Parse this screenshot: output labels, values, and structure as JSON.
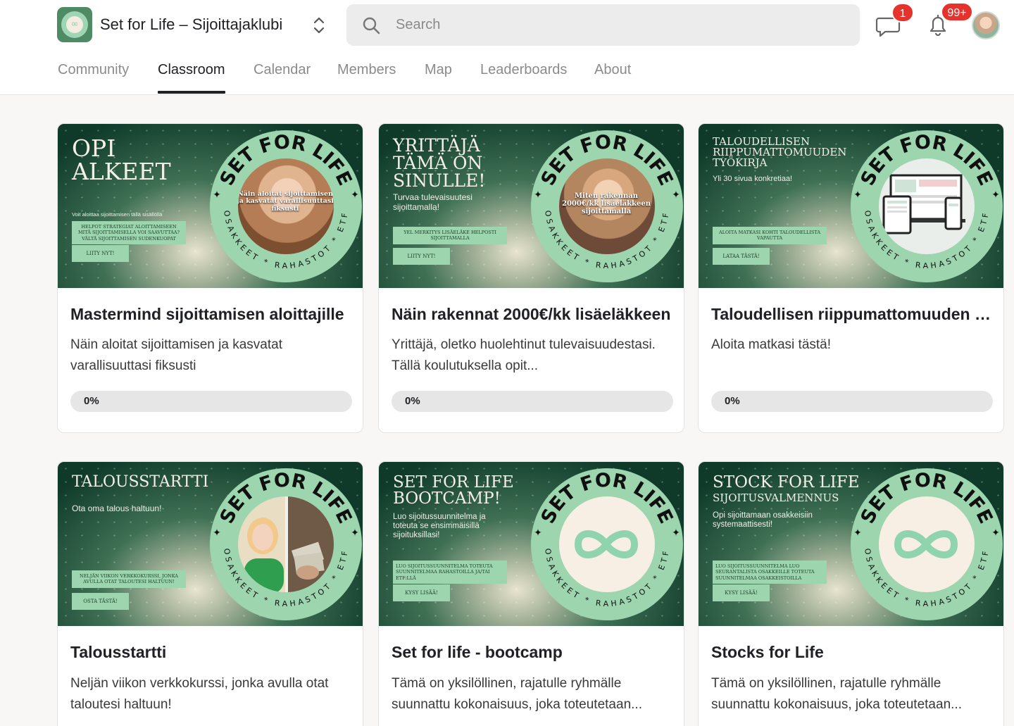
{
  "header": {
    "group_name": "Set for Life – Sijoittajaklubi",
    "search_placeholder": "Search",
    "chat_badge": "1",
    "notifications_badge": "99+"
  },
  "tabs": [
    {
      "label": "Community",
      "active": false
    },
    {
      "label": "Classroom",
      "active": true
    },
    {
      "label": "Calendar",
      "active": false
    },
    {
      "label": "Members",
      "active": false
    },
    {
      "label": "Map",
      "active": false
    },
    {
      "label": "Leaderboards",
      "active": false
    },
    {
      "label": "About",
      "active": false
    }
  ],
  "colors": {
    "accent_green": "#9cd5ae",
    "badge_red": "#e5322d",
    "cover_dark": "#0f3a2a"
  },
  "ring": {
    "top_text": "SET FOR LIFE",
    "bottom_text": "OSAKKEET * RAHASTOT * ETF"
  },
  "courses": [
    {
      "cover_title": "OPI ALKEET",
      "cover_subtitle": "Voit aloittaa sijoittamisen tällä sisällöllä",
      "cover_pill": "HELPOT STRATEGIAT ALOITTAMISEEN MITÄ SIJOITTAMISELLA VOI SAAVUTTAA? VÄLTÄ SIJOITTAMISEN SUDENKUOPAT",
      "cover_button": "LIITY NYT!",
      "photo_caption": "Näin aloitat sijoittamisen ja kasvatat varallisuuttasi fiksusti",
      "title": "Mastermind sijoittamisen aloittajille",
      "description": "Näin aloitat sijoittamisen ja kasvatat varallisuuttasi fiksusti",
      "progress": 0,
      "progress_label": "0%"
    },
    {
      "cover_title": "YRITTÄJÄ TÄMÄ ON SINULLE!",
      "cover_subtitle": "Turvaa tulevaisuutesi sijoittamalla!",
      "cover_pill": "YEL MERKITYS LISÄELÄKE HELPOSTI SIJOITTAMALLA",
      "cover_button": "LIITY NYT!",
      "photo_caption": "Miten rakennan 2000€/kk lisäeläkkeen sijoittamalla",
      "title": "Näin rakennat 2000€/kk lisäeläkkeen",
      "description": "Yrittäjä, oletko huolehtinut tulevaisuudestasi. Tällä koulutuksella opit...",
      "progress": 0,
      "progress_label": "0%"
    },
    {
      "cover_title": "TALOUDELLISEN RIIPPUMATTOMUUDEN TYÖKIRJA",
      "cover_subtitle": "Yli 30 sivua konkretiaa!",
      "cover_pill": "ALOITA MATKASI KOHTI TALOUDELLISTA VAPAUTTA",
      "cover_button": "LATAA TÄSTÄ!",
      "photo_caption": "",
      "title": "Taloudellisen riippumattomuuden työkirja",
      "description": "Aloita matkasi tästä!",
      "progress": 0,
      "progress_label": "0%"
    },
    {
      "cover_title": "TALOUSSTARTTI",
      "cover_subtitle": "Ota oma talous haltuun!",
      "cover_pill": "NELJÄN VIIKON VERKKOKURSSI, JONKA AVULLA OTAT TALOUTESI HALTUUN!",
      "cover_button": "OSTA TÄSTÄ!",
      "photo_caption": "",
      "title": "Talousstartti",
      "description": "Neljän viikon verkkokurssi, jonka avulla otat taloutesi haltuun!",
      "progress": 0,
      "progress_label": ""
    },
    {
      "cover_title": "SET FOR LIFE BOOTCAMP!",
      "cover_subtitle": "Luo sijoitussuunnitelma ja toteuta se ensimmäisillä sijoituksillasi!",
      "cover_pill": "LUO SIJOITUSSUUNNITELMA TOTEUTA SUUNNITELMAA RAHASTOILLA JA/TAI ETF:LLÄ",
      "cover_button": "KYSY LISÄÄ!",
      "photo_caption": "",
      "title": "Set for life - bootcamp",
      "description": "Tämä on yksilöllinen, rajatulle ryhmälle suunnattu kokonaisuus, joka toteutetaan...",
      "progress": 0,
      "progress_label": ""
    },
    {
      "cover_title": "STOCK FOR LIFE",
      "cover_title_line2": "SIJOITUSVALMENNUS",
      "cover_subtitle": "Opi sijoittamaan osakkeisiin systemaattisesti!",
      "cover_pill": "LUO SIJOITUSSUUNNITELMA LUO SEURANTALISTA OSAKKEILLE TOTEUTA SUUNNITELMAA OSAKKEISTOILLA",
      "cover_button": "KYSY LISÄÄ!",
      "photo_caption": "",
      "title": "Stocks for Life",
      "description": "Tämä on yksilöllinen, rajatulle ryhmälle suunnattu kokonaisuus, joka toteutetaan...",
      "progress": 0,
      "progress_label": ""
    }
  ]
}
